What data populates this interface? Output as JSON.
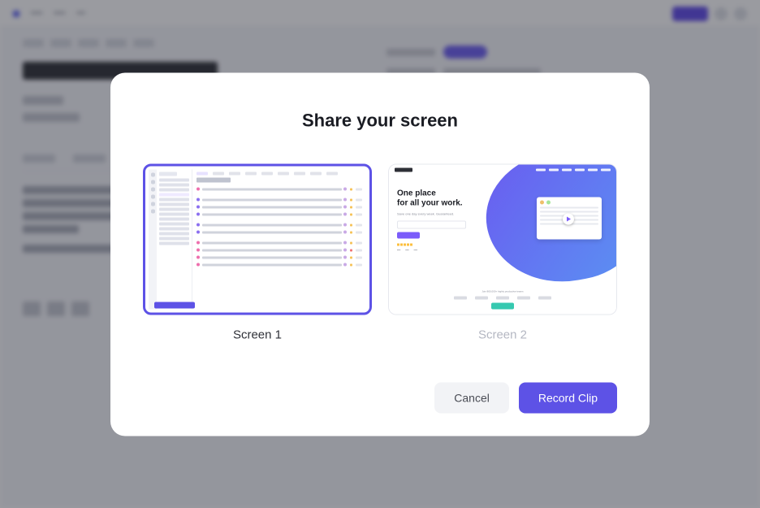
{
  "modal": {
    "title": "Share your screen",
    "screens": [
      {
        "label": "Screen 1",
        "selected": true
      },
      {
        "label": "Screen 2",
        "selected": false
      }
    ],
    "cancel_label": "Cancel",
    "record_label": "Record Clip"
  },
  "thumb2": {
    "heading_line1": "One place",
    "heading_line2": "for all your work.",
    "subtitle": "Save one day every week. Guaranteed.",
    "footer_text": "Join 800,000+ highly productive teams",
    "brand": "ClickUp"
  },
  "background": {
    "title": "Task View Redesign",
    "crumbs": [
      "Space",
      "Project",
      "List"
    ]
  }
}
